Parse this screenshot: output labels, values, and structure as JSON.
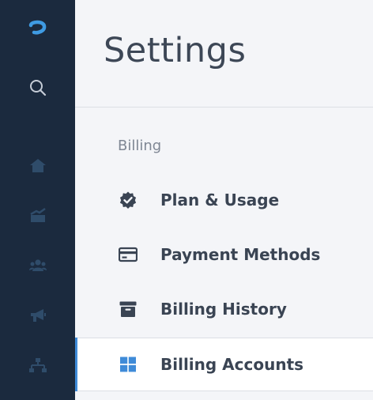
{
  "sidebar": {
    "items": [
      {
        "icon": "logo-icon"
      },
      {
        "icon": "search-icon"
      },
      {
        "icon": "home-icon"
      },
      {
        "icon": "chart-icon"
      },
      {
        "icon": "people-icon"
      },
      {
        "icon": "megaphone-icon"
      },
      {
        "icon": "sitemap-icon"
      }
    ],
    "background": "#1b2a3e",
    "accent": "#3f8bd8"
  },
  "page": {
    "title": "Settings"
  },
  "billing": {
    "section_label": "Billing",
    "items": [
      {
        "label": "Plan & Usage",
        "icon": "verified-badge-icon"
      },
      {
        "label": "Payment Methods",
        "icon": "credit-card-icon"
      },
      {
        "label": "Billing History",
        "icon": "archive-box-icon"
      },
      {
        "label": "Billing Accounts",
        "icon": "grid-icon",
        "active": true
      }
    ]
  }
}
